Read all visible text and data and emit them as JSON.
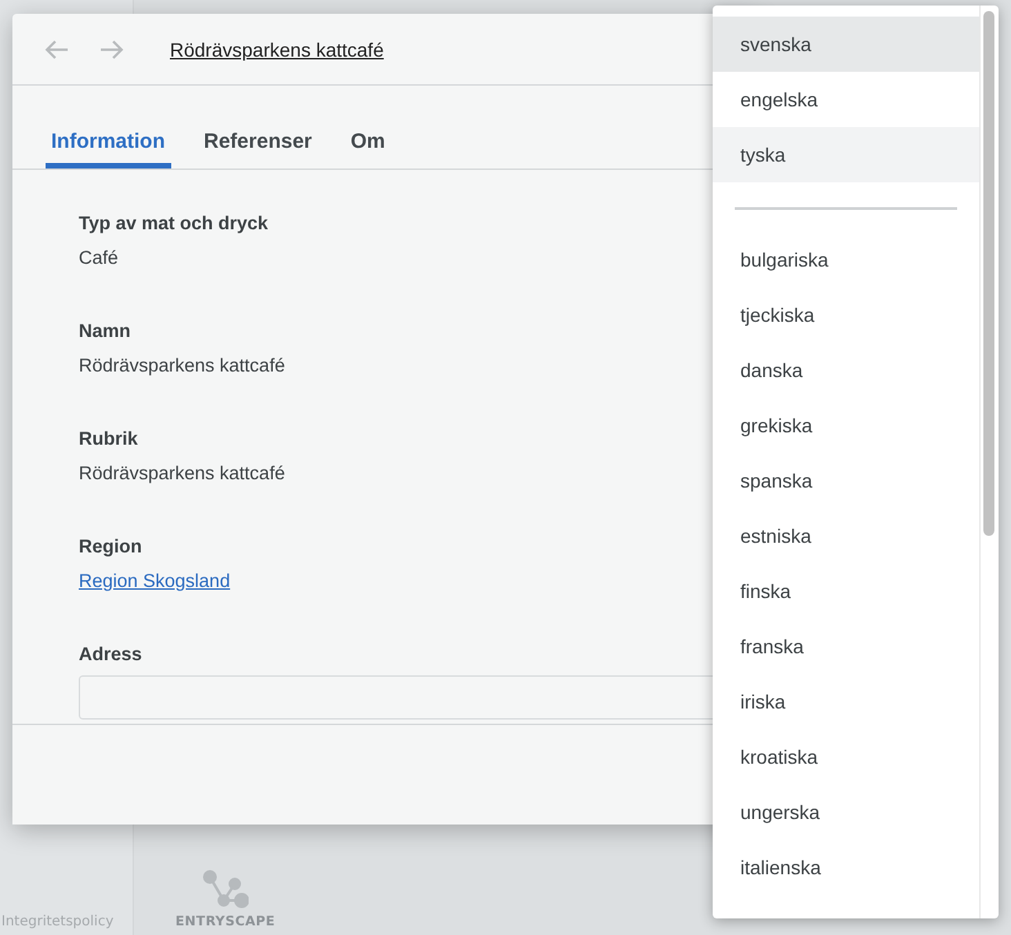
{
  "background": {
    "footer_link": "Integritetspolicy",
    "logo_text": "ENTRYSCAPE"
  },
  "dialog": {
    "nav": [
      {
        "kind": "back",
        "disabled": true
      },
      {
        "kind": "forward",
        "disabled": true
      }
    ],
    "title": "Rödrävsparkens kattcafé",
    "tabs": [
      {
        "label": "Information",
        "selected": true
      },
      {
        "label": "Referenser",
        "selected": false
      },
      {
        "label": "Om",
        "selected": false
      }
    ],
    "fields": [
      {
        "label": "Typ av mat och dryck",
        "value": "Café",
        "kind": "text"
      },
      {
        "label": "Namn",
        "value": "Rödrävsparkens kattcafé",
        "kind": "text"
      },
      {
        "label": "Rubrik",
        "value": "Rödrävsparkens kattcafé",
        "kind": "text"
      },
      {
        "label": "Region",
        "value": "Region Skogsland",
        "kind": "link"
      },
      {
        "label": "Adress",
        "kind": "box"
      }
    ]
  },
  "language_menu": {
    "top": [
      {
        "label": "svenska",
        "selected": true,
        "highlighted": false
      },
      {
        "label": "engelska",
        "selected": false,
        "highlighted": false
      },
      {
        "label": "tyska",
        "selected": false,
        "highlighted": true
      }
    ],
    "others": [
      {
        "label": "bulgariska",
        "selected": false
      },
      {
        "label": "tjeckiska",
        "selected": false
      },
      {
        "label": "danska",
        "selected": false
      },
      {
        "label": "grekiska",
        "selected": false
      },
      {
        "label": "spanska",
        "selected": false
      },
      {
        "label": "estniska",
        "selected": false
      },
      {
        "label": "finska",
        "selected": false
      },
      {
        "label": "franska",
        "selected": false
      },
      {
        "label": "iriska",
        "selected": false
      },
      {
        "label": "kroatiska",
        "selected": false
      },
      {
        "label": "ungerska",
        "selected": false
      },
      {
        "label": "italienska",
        "selected": false
      }
    ]
  }
}
